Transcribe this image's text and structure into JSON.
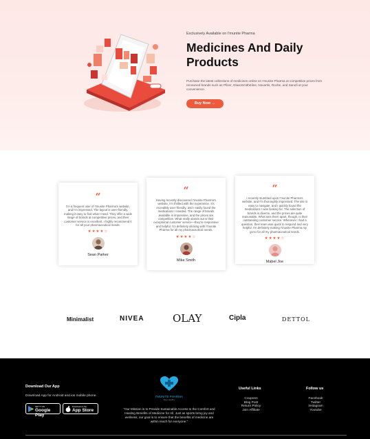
{
  "hero": {
    "kicker": "Exclusively Available on I'munite Pharma",
    "title": "Medicines And Daily Products",
    "description": "Purchase the latest collections of medicines online on I'munite Pharma at competitive prices from renowned brands such as Pfizer, GlaxoSmithKline, Novartis, Roche, and Sanofi at your convenience.",
    "cta_label": "Buy Now →"
  },
  "testimonials": [
    {
      "quote": "I'm a frequent user of I'munite Pharma's website, and I'm impressed. The layout is user-friendly, making it easy to find what I need. They offer a wide range of brands at competitive prices, and their customer service is excellent. I highly recommend it for all your pharmaceutical needs.",
      "stars": "★★★★☆",
      "rating": 4,
      "name": "Sean Parker"
    },
    {
      "quote": "Having recently discovered I'munite Pharma's website, I'm thrilled with the experience. It's incredibly user-friendly, and I easily found the medications I needed. The range of brands available is impressive, and the prices are competitive. What really stands out is their exceptional customer service—they're responsive and helpful. I'm definitely sticking with I'munite Pharma for all my pharmaceutical needs.",
      "stars": "★★★★☆",
      "rating": 4,
      "name": "Mike Smith"
    },
    {
      "quote": "I recently stumbled upon I'munite Pharma's website, and I'm thoroughly impressed. The site is easy to navigate, and I quickly found the medications I was looking for. The selection of brands is diverse, and the prices are quite reasonable. What sets them apart, though, is their outstanding customer service. Whenever I had a question, their team was quick to respond and very helpful. I'm definitely making I'munite Pharma my go-to for all my pharmaceutical needs.",
      "stars": "★★★★☆",
      "rating": 4,
      "name": "Mabel Joe"
    }
  ],
  "brands": [
    "Minimalist",
    "NIVEA",
    "OLAY",
    "Cipla",
    "DETTOL"
  ],
  "footer": {
    "download_title": "Download Our App",
    "download_text": "Download App for Android and ios mobile phone.",
    "google_play_small": "GET IT ON",
    "google_play_big": "Google Play",
    "app_store_small": "Download on the",
    "app_store_big": "App Store",
    "logo_name": "I'MUNITE PHARMA",
    "logo_tagline": "Stay Healthy",
    "mission": "\"Our Mission is to Provide Sustainable Access to the Comfort and Healing Benefits of Medicine for All. Just as sports bring joy and wellness, our goal is to ensure that the benefits of medicine are within reach for everyone.\"",
    "useful_links_title": "Useful Links",
    "useful_links": [
      "Coupons",
      "Blog Post",
      "Return Policy",
      "Join Affiliate"
    ],
    "follow_title": "Follow us",
    "follow_links": [
      "Facebook",
      "Twitter",
      "Instagram",
      "Youtube"
    ]
  },
  "colors": {
    "accent": "#ee5a3c",
    "hero_bg": "#fde8e6",
    "footer_bg": "#000000"
  }
}
